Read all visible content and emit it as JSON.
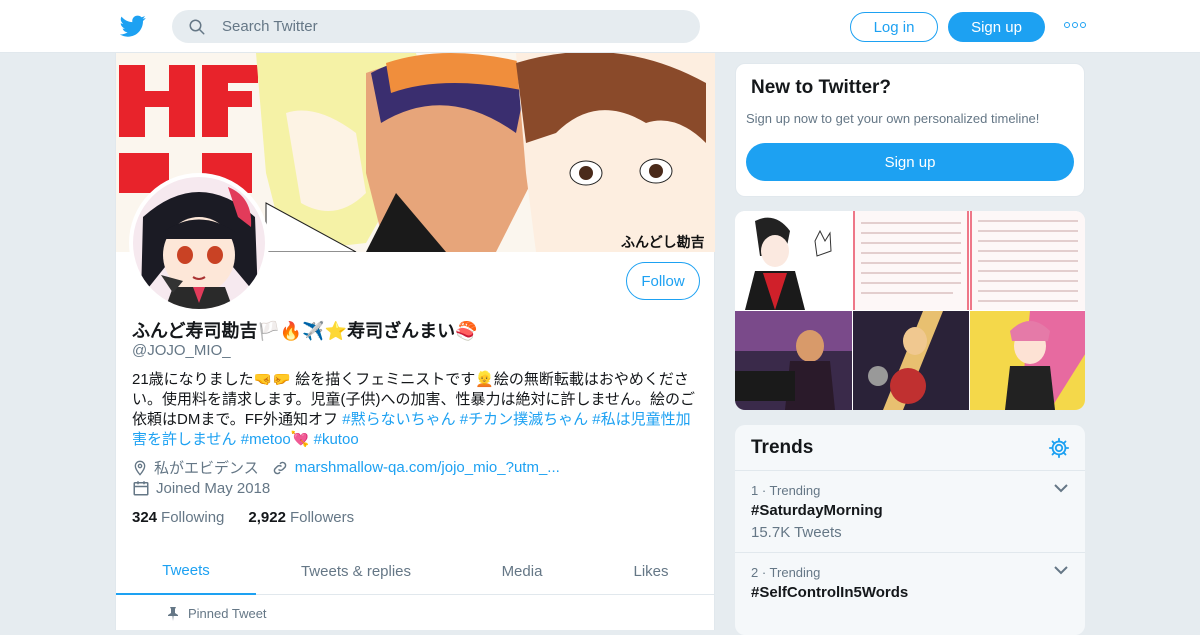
{
  "topbar": {
    "search_placeholder": "Search Twitter",
    "login_label": "Log in",
    "signup_label": "Sign up"
  },
  "colors": {
    "accent": "#1da1f2",
    "secondary_text": "#657786",
    "background": "#e6ecf0"
  },
  "profile": {
    "banner_text": "ふんどし勘吉",
    "follow_label": "Follow",
    "display_name": "ふんど寿司勘吉🏳️🔥✈️⭐寿司ざんまい🍣",
    "handle": "@JOJO_MIO_",
    "bio_text": "21歳になりました🤜🤛 絵を描くフェミニストです👱絵の無断転載はおやめください。使用料を請求します。児童(子供)への加害、性暴力は絶対に許しません。絵のご依頼はDMまで。FF外通知オフ ",
    "bio_tags": [
      "#黙らないちゃん",
      "#チカン撲滅ちゃん",
      "#私は児童性加害を許しません",
      "#metoo💘",
      "#kutoo"
    ],
    "location": "私がエビデンス",
    "website": "marshmallow-qa.com/jojo_mio_?utm_...",
    "joined": "Joined May 2018",
    "following_count": "324",
    "following_label": "Following",
    "followers_count": "2,922",
    "followers_label": "Followers"
  },
  "tabs": [
    {
      "label": "Tweets"
    },
    {
      "label": "Tweets & replies"
    },
    {
      "label": "Media"
    },
    {
      "label": "Likes"
    }
  ],
  "pinned_label": "Pinned Tweet",
  "new_to_twitter": {
    "title": "New to Twitter?",
    "subtitle": "Sign up now to get your own personalized timeline!",
    "signup_label": "Sign up"
  },
  "trends": {
    "title": "Trends",
    "items": [
      {
        "rank": "1 · Trending",
        "name": "#SaturdayMorning",
        "count": "15.7K Tweets"
      },
      {
        "rank": "2 · Trending",
        "name": "#SelfControlIn5Words",
        "count": ""
      }
    ]
  }
}
